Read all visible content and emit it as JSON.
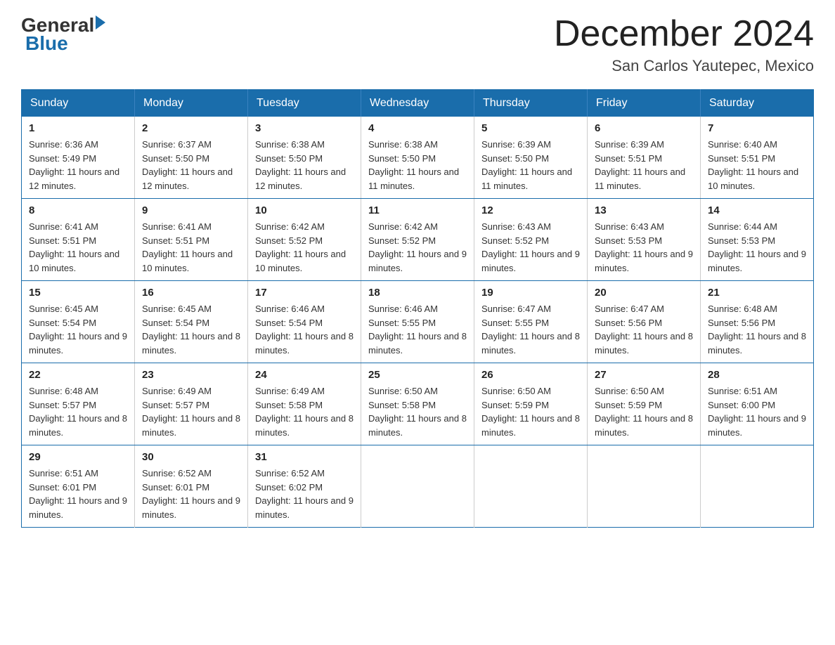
{
  "logo": {
    "general": "General",
    "triangle": "▶",
    "blue": "Blue"
  },
  "title": {
    "month": "December 2024",
    "location": "San Carlos Yautepec, Mexico"
  },
  "headers": [
    "Sunday",
    "Monday",
    "Tuesday",
    "Wednesday",
    "Thursday",
    "Friday",
    "Saturday"
  ],
  "weeks": [
    [
      {
        "day": "1",
        "sunrise": "6:36 AM",
        "sunset": "5:49 PM",
        "daylight": "11 hours and 12 minutes."
      },
      {
        "day": "2",
        "sunrise": "6:37 AM",
        "sunset": "5:50 PM",
        "daylight": "11 hours and 12 minutes."
      },
      {
        "day": "3",
        "sunrise": "6:38 AM",
        "sunset": "5:50 PM",
        "daylight": "11 hours and 12 minutes."
      },
      {
        "day": "4",
        "sunrise": "6:38 AM",
        "sunset": "5:50 PM",
        "daylight": "11 hours and 11 minutes."
      },
      {
        "day": "5",
        "sunrise": "6:39 AM",
        "sunset": "5:50 PM",
        "daylight": "11 hours and 11 minutes."
      },
      {
        "day": "6",
        "sunrise": "6:39 AM",
        "sunset": "5:51 PM",
        "daylight": "11 hours and 11 minutes."
      },
      {
        "day": "7",
        "sunrise": "6:40 AM",
        "sunset": "5:51 PM",
        "daylight": "11 hours and 10 minutes."
      }
    ],
    [
      {
        "day": "8",
        "sunrise": "6:41 AM",
        "sunset": "5:51 PM",
        "daylight": "11 hours and 10 minutes."
      },
      {
        "day": "9",
        "sunrise": "6:41 AM",
        "sunset": "5:51 PM",
        "daylight": "11 hours and 10 minutes."
      },
      {
        "day": "10",
        "sunrise": "6:42 AM",
        "sunset": "5:52 PM",
        "daylight": "11 hours and 10 minutes."
      },
      {
        "day": "11",
        "sunrise": "6:42 AM",
        "sunset": "5:52 PM",
        "daylight": "11 hours and 9 minutes."
      },
      {
        "day": "12",
        "sunrise": "6:43 AM",
        "sunset": "5:52 PM",
        "daylight": "11 hours and 9 minutes."
      },
      {
        "day": "13",
        "sunrise": "6:43 AM",
        "sunset": "5:53 PM",
        "daylight": "11 hours and 9 minutes."
      },
      {
        "day": "14",
        "sunrise": "6:44 AM",
        "sunset": "5:53 PM",
        "daylight": "11 hours and 9 minutes."
      }
    ],
    [
      {
        "day": "15",
        "sunrise": "6:45 AM",
        "sunset": "5:54 PM",
        "daylight": "11 hours and 9 minutes."
      },
      {
        "day": "16",
        "sunrise": "6:45 AM",
        "sunset": "5:54 PM",
        "daylight": "11 hours and 8 minutes."
      },
      {
        "day": "17",
        "sunrise": "6:46 AM",
        "sunset": "5:54 PM",
        "daylight": "11 hours and 8 minutes."
      },
      {
        "day": "18",
        "sunrise": "6:46 AM",
        "sunset": "5:55 PM",
        "daylight": "11 hours and 8 minutes."
      },
      {
        "day": "19",
        "sunrise": "6:47 AM",
        "sunset": "5:55 PM",
        "daylight": "11 hours and 8 minutes."
      },
      {
        "day": "20",
        "sunrise": "6:47 AM",
        "sunset": "5:56 PM",
        "daylight": "11 hours and 8 minutes."
      },
      {
        "day": "21",
        "sunrise": "6:48 AM",
        "sunset": "5:56 PM",
        "daylight": "11 hours and 8 minutes."
      }
    ],
    [
      {
        "day": "22",
        "sunrise": "6:48 AM",
        "sunset": "5:57 PM",
        "daylight": "11 hours and 8 minutes."
      },
      {
        "day": "23",
        "sunrise": "6:49 AM",
        "sunset": "5:57 PM",
        "daylight": "11 hours and 8 minutes."
      },
      {
        "day": "24",
        "sunrise": "6:49 AM",
        "sunset": "5:58 PM",
        "daylight": "11 hours and 8 minutes."
      },
      {
        "day": "25",
        "sunrise": "6:50 AM",
        "sunset": "5:58 PM",
        "daylight": "11 hours and 8 minutes."
      },
      {
        "day": "26",
        "sunrise": "6:50 AM",
        "sunset": "5:59 PM",
        "daylight": "11 hours and 8 minutes."
      },
      {
        "day": "27",
        "sunrise": "6:50 AM",
        "sunset": "5:59 PM",
        "daylight": "11 hours and 8 minutes."
      },
      {
        "day": "28",
        "sunrise": "6:51 AM",
        "sunset": "6:00 PM",
        "daylight": "11 hours and 9 minutes."
      }
    ],
    [
      {
        "day": "29",
        "sunrise": "6:51 AM",
        "sunset": "6:01 PM",
        "daylight": "11 hours and 9 minutes."
      },
      {
        "day": "30",
        "sunrise": "6:52 AM",
        "sunset": "6:01 PM",
        "daylight": "11 hours and 9 minutes."
      },
      {
        "day": "31",
        "sunrise": "6:52 AM",
        "sunset": "6:02 PM",
        "daylight": "11 hours and 9 minutes."
      },
      null,
      null,
      null,
      null
    ]
  ],
  "labels": {
    "sunrise": "Sunrise:",
    "sunset": "Sunset:",
    "daylight": "Daylight:"
  }
}
